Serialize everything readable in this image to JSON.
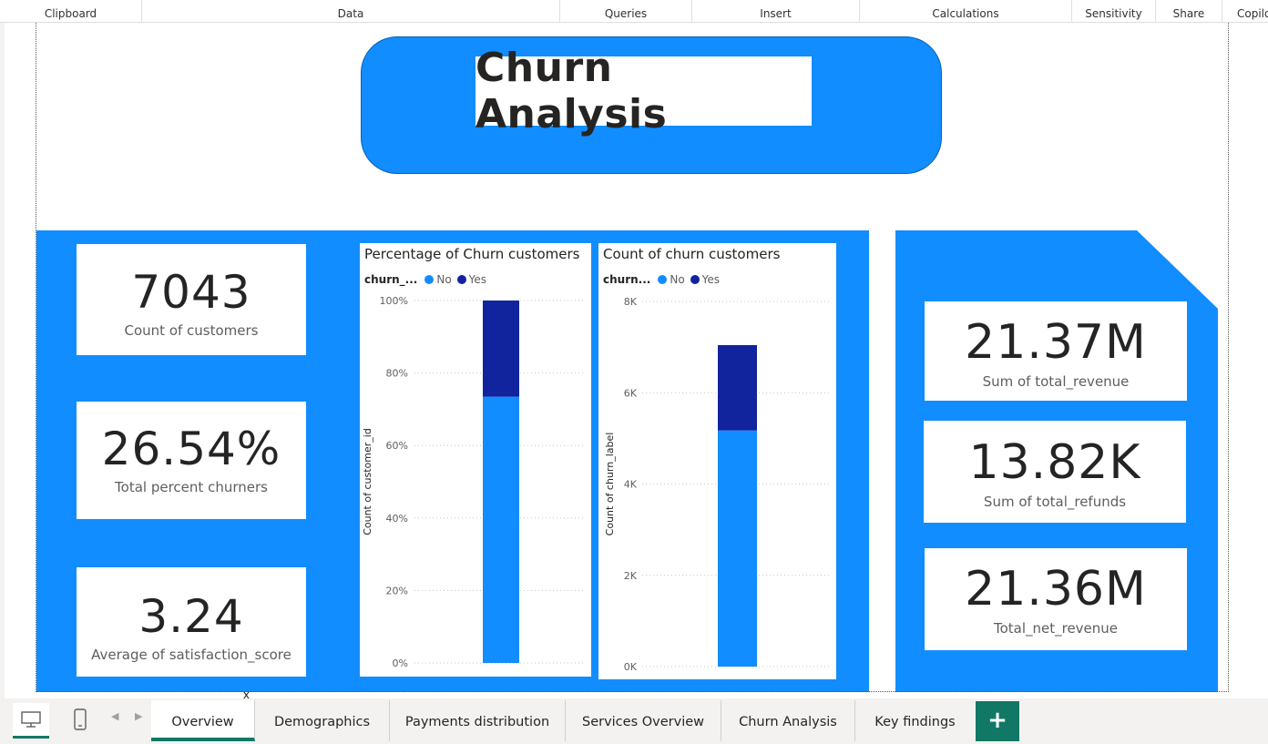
{
  "ribbon": {
    "groups": [
      "Clipboard",
      "Data",
      "Queries",
      "Insert",
      "Calculations",
      "Sensitivity",
      "Share",
      "Copilo"
    ]
  },
  "report": {
    "title": "Churn Analysis",
    "kpis_left": [
      {
        "value": "7043",
        "label": "Count of customers"
      },
      {
        "value": "26.54%",
        "label": "Total percent churners"
      },
      {
        "value": "3.24",
        "label": "Average of satisfaction_score"
      }
    ],
    "kpis_right": [
      {
        "value": "21.37M",
        "label": "Sum of total_revenue"
      },
      {
        "value": "13.82K",
        "label": "Sum of total_refunds"
      },
      {
        "value": "21.36M",
        "label": "Total_net_revenue"
      }
    ]
  },
  "colors": {
    "accent": "#118dff",
    "series_no": "#118dff",
    "series_yes": "#12239e",
    "tab_accent": "#117865"
  },
  "chart_data": [
    {
      "type": "bar",
      "stacked": true,
      "title": "Percentage of Churn customers",
      "legend_title": "churn_...",
      "ylabel": "Count of customer_id",
      "yticks": [
        "0%",
        "20%",
        "40%",
        "60%",
        "80%",
        "100%"
      ],
      "ylim": [
        0,
        100
      ],
      "series": [
        {
          "name": "No",
          "values": [
            73.46
          ]
        },
        {
          "name": "Yes",
          "values": [
            26.54
          ]
        }
      ]
    },
    {
      "type": "bar",
      "stacked": true,
      "title": "Count of churn customers",
      "legend_title": "churn...",
      "ylabel": "Count of churn_label",
      "yticks": [
        "0K",
        "2K",
        "4K",
        "6K",
        "8K"
      ],
      "ylim": [
        0,
        8000
      ],
      "series": [
        {
          "name": "No",
          "values": [
            5174
          ]
        },
        {
          "name": "Yes",
          "values": [
            1869
          ]
        }
      ]
    }
  ],
  "tabs": {
    "pages": [
      "Overview",
      "Demographics",
      "Payments distribution",
      "Services Overview",
      "Churn Analysis",
      "Key findings"
    ],
    "active": "Overview",
    "close_label": "x",
    "add_label": "+"
  }
}
